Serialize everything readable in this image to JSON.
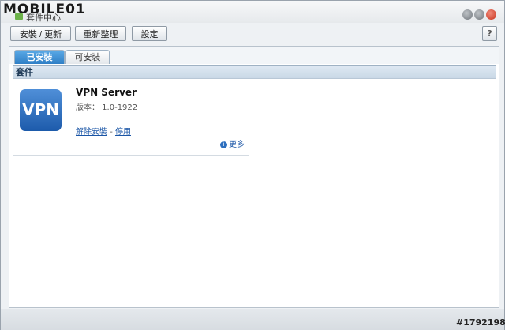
{
  "watermark": "MOBILE01",
  "window": {
    "title": "套件中心"
  },
  "toolbar": {
    "install_update_label": "安裝 / 更新",
    "reorganize_label": "重新整理",
    "settings_label": "設定",
    "help_label": "?"
  },
  "tabs": [
    {
      "label": "已安裝"
    },
    {
      "label": "可安裝"
    }
  ],
  "section": {
    "header": "套件"
  },
  "package": {
    "icon_text": "VPN",
    "name": "VPN Server",
    "version": "版本： 1.0-1922",
    "uninstall_label": "解除安裝",
    "separator": "-",
    "disable_label": "停用",
    "more_label": "更多"
  },
  "photo_id": "#1792198",
  "colors": {
    "active_tab": "#2f7fc6",
    "close_button": "#c8321d",
    "link": "#1a55a6"
  }
}
